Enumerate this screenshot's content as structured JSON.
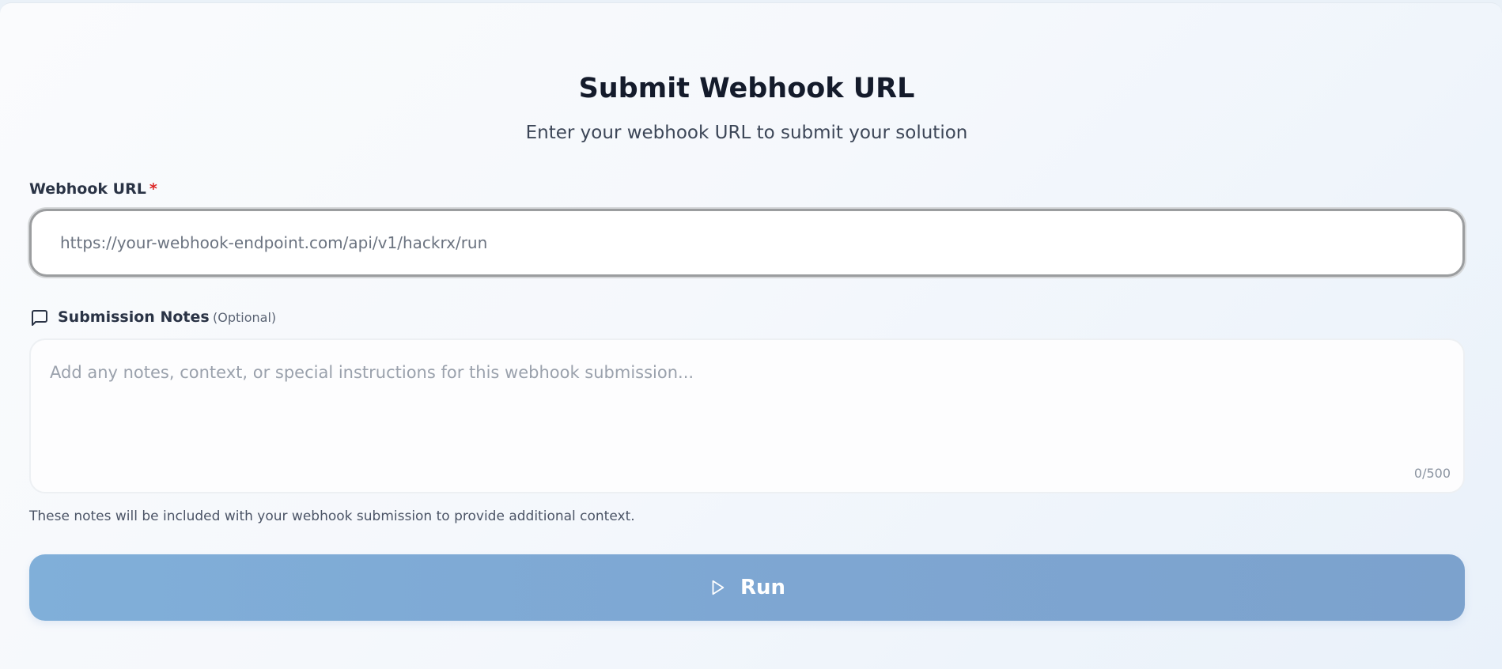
{
  "header": {
    "title": "Submit Webhook URL",
    "subtitle": "Enter your webhook URL to submit your solution"
  },
  "webhook": {
    "label": "Webhook URL",
    "required_marker": "*",
    "value": "",
    "placeholder": "https://your-webhook-endpoint.com/api/v1/hackrx/run"
  },
  "notes": {
    "icon": "message-square-icon",
    "label": "Submission Notes",
    "optional_text": "(Optional)",
    "value": "",
    "placeholder": "Add any notes, context, or special instructions for this webhook submission...",
    "char_count": "0/500",
    "help_text": "These notes will be included with your webhook submission to provide additional context."
  },
  "run_button": {
    "icon": "play-icon",
    "label": "Run"
  },
  "colors": {
    "accent": "#7ea6d2",
    "required": "#dc2626",
    "title": "#141b2b"
  }
}
